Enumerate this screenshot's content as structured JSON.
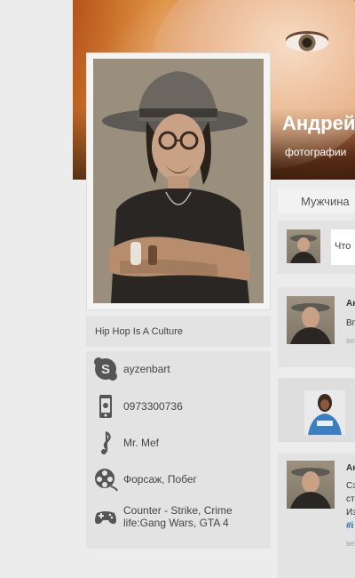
{
  "profile": {
    "name": "Андрей",
    "subtitle": "фотографии",
    "bio": "Hip Hop Is A Culture"
  },
  "info": [
    {
      "icon": "skype-icon",
      "text": "ayzenbart"
    },
    {
      "icon": "phone-icon",
      "text": "0973300736"
    },
    {
      "icon": "music-note-icon",
      "text": "Mr. Mef"
    },
    {
      "icon": "film-reel-icon",
      "text": "Форсаж, Побег"
    },
    {
      "icon": "gamepad-icon",
      "text": "Counter - Strike, Crime life:Gang Wars, GTA 4"
    }
  ],
  "right": {
    "gender": "Мужчина",
    "post_placeholder": "Что",
    "feed": [
      {
        "author": "Ан",
        "line1": "Вп",
        "time": "веч"
      },
      {
        "author": "Ан",
        "line1": "Сэ",
        "line2": "ст",
        "line3": "Из",
        "tag": "#i",
        "time": "веч"
      }
    ]
  }
}
